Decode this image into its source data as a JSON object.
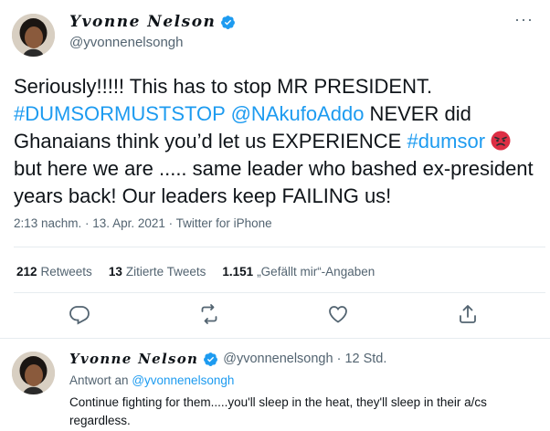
{
  "tweet": {
    "display_name": "Yvonne Nelson",
    "handle": "@yvonnenelsongh",
    "text_parts": [
      {
        "text": "Seriously!!!!! This has to stop MR PRESIDENT. ",
        "link": false
      },
      {
        "text": "#DUMSORMUSTSTOP",
        "link": true
      },
      {
        "text": " ",
        "link": false
      },
      {
        "text": "@NAkufoAddo",
        "link": true
      },
      {
        "text": " NEVER did Ghanaians think you’d let us EXPERIENCE ",
        "link": false
      },
      {
        "text": "#dumsor",
        "link": true
      },
      {
        "text": " ",
        "link": false
      },
      {
        "text": " but here we are ..... same leader who bashed ex-president years back! Our leaders keep FAILING us!",
        "link": false
      }
    ],
    "emoji": "angry-face-emoji",
    "timestamp": "2:13 nachm. · 13. Apr. 2021 · Twitter for iPhone",
    "stats": {
      "retweets_count": "212",
      "retweets_label": "Retweets",
      "quotes_count": "13",
      "quotes_label": "Zitierte Tweets",
      "likes_count": "1.151",
      "likes_label": "„Gefällt mir“-Angaben"
    },
    "actions": [
      "reply-icon",
      "retweet-icon",
      "like-icon",
      "share-icon"
    ]
  },
  "reply": {
    "display_name": "Yvonne Nelson",
    "handle_time": "@yvonnenelsongh · 12 Std.",
    "reply_to_prefix": "Antwort an",
    "reply_to_handle": "@yvonnenelsongh",
    "text": "Continue fighting for them.....you'll sleep in the heat, they'll sleep in their a/cs regardless."
  },
  "colors": {
    "link": "#1d9bf0",
    "verified": "#1d9bf0",
    "secondary_text": "#536471",
    "divider": "#e6ecf0"
  }
}
